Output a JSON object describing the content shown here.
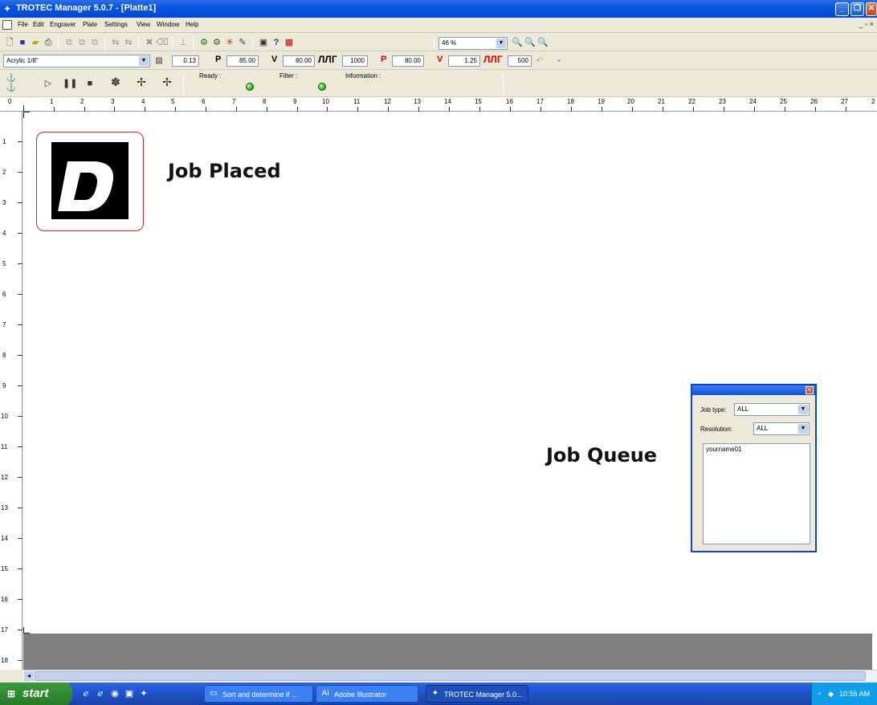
{
  "window": {
    "title": "TROTEC Manager 5.0.7 - [Platte1]",
    "minimize": "_",
    "restore": "❐",
    "close": "✕",
    "mdi_controls": "_ ▫ ×"
  },
  "menu": [
    "File",
    "Edit",
    "Engraver",
    "Plate",
    "Settings",
    "View",
    "Window",
    "Help"
  ],
  "toolbar1": {
    "zoom_value": "46 %"
  },
  "toolbar2": {
    "material": "Acrylic 1/8\"",
    "hatch_value": "0.13",
    "p_label": "P",
    "p_value": "85.00",
    "v_label": "V",
    "v_value": "80.00",
    "ppi_value": "1000",
    "p2_label": "P",
    "p2_value": "80.00",
    "v2_label": "V",
    "v2_value": "1.25",
    "hz_value": "500"
  },
  "toolbar3": {
    "ready_label": "Ready :",
    "filter_label": "Filter :",
    "information_label": "Information :"
  },
  "ruler": {
    "h": [
      "0",
      "1",
      "2",
      "3",
      "4",
      "5",
      "6",
      "7",
      "8",
      "9",
      "10",
      "11",
      "12",
      "13",
      "14",
      "15",
      "16",
      "17",
      "18",
      "19",
      "20",
      "21",
      "22",
      "23",
      "24",
      "25",
      "26",
      "27",
      "2"
    ],
    "v": [
      "1",
      "2",
      "3",
      "4",
      "5",
      "6",
      "7",
      "8",
      "9",
      "10",
      "11",
      "12",
      "13",
      "14",
      "15",
      "16",
      "17",
      "18"
    ]
  },
  "canvas": {
    "job_placed_label": "Job Placed",
    "job_queue_label": "Job Queue",
    "job_letter": "D"
  },
  "queue": {
    "close": "✕",
    "job_type_label": "Job type:",
    "job_type_value": "ALL",
    "resolution_label": "Resolution:",
    "resolution_value": "ALL",
    "items": [
      "yourname01"
    ]
  },
  "taskbar": {
    "start": "start",
    "tasks": [
      "Sort and determine if ...",
      "Adobe Illustrator",
      "TROTEC Manager 5.0..."
    ],
    "clock": "10:56 AM"
  }
}
